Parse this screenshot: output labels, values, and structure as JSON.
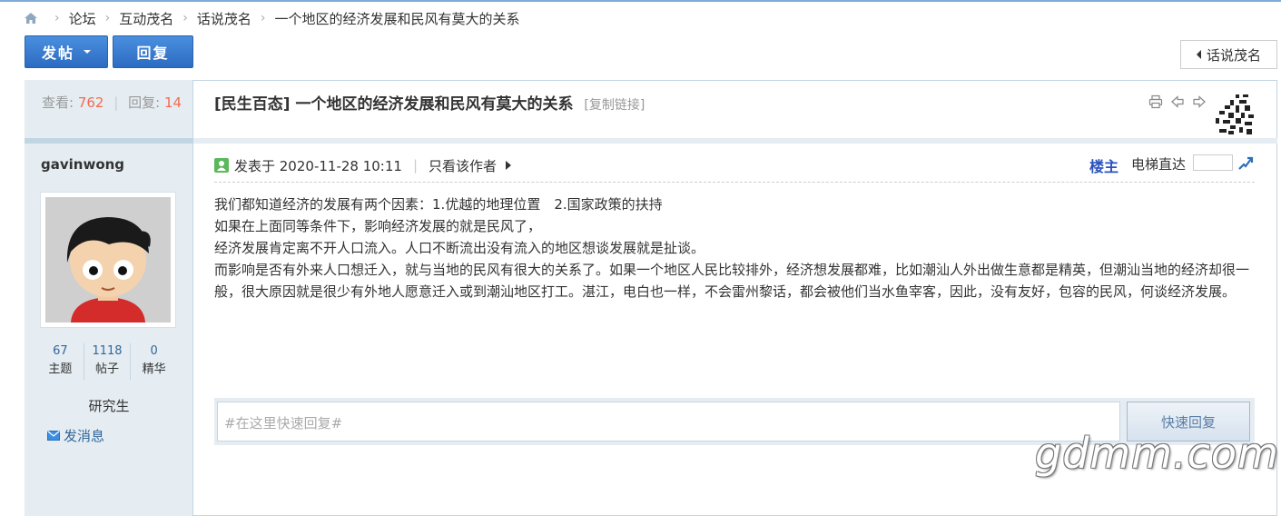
{
  "breadcrumb": {
    "home_icon": "home-icon",
    "items": [
      "论坛",
      "互动茂名",
      "话说茂名",
      "一个地区的经济发展和民风有莫大的关系"
    ]
  },
  "toolbar": {
    "post_label": "发帖",
    "reply_label": "回复",
    "back_label": "话说茂名"
  },
  "thread": {
    "views_label": "查看:",
    "views": "762",
    "replies_label": "回复:",
    "replies": "14",
    "title": "[民生百态] 一个地区的经济发展和民风有莫大的关系",
    "copy_link": "[复制链接]"
  },
  "author": {
    "name": "gavinwong",
    "stats": [
      {
        "value": "67",
        "label": "主题"
      },
      {
        "value": "1118",
        "label": "帖子"
      },
      {
        "value": "0",
        "label": "精华"
      }
    ],
    "rank": "研究生",
    "send_message": "发消息"
  },
  "post": {
    "posted_at": "发表于 2020-11-28 10:11",
    "only_author": "只看该作者",
    "floor": "楼主",
    "elevator": "电梯直达",
    "lines": [
      "我们都知道经济的发展有两个因素：1.优越的地理位置　2.国家政策的扶持",
      "如果在上面同等条件下，影响经济发展的就是民风了，",
      "经济发展肯定离不开人口流入。人口不断流出没有流入的地区想谈发展就是扯谈。",
      "而影响是否有外来人口想迁入，就与当地的民风有很大的关系了。如果一个地区人民比较排外，经济想发展都难，比如潮汕人外出做生意都是精英，但潮汕当地的经济却很一般，很大原因就是很少有外地人愿意迁入或到潮汕地区打工。湛江，电白也一样，不会雷州黎话，都会被他们当水鱼宰客，因此，没有友好，包容的民风，何谈经济发展。"
    ]
  },
  "quick_reply": {
    "placeholder": "#在这里快速回复#",
    "button": "快速回复"
  },
  "watermark": "gdmm.com",
  "colors": {
    "accent": "#2c6bc2",
    "highlight": "#f26c4f",
    "link": "#336699",
    "panel": "#e5edf2",
    "border": "#c2d5e3"
  }
}
